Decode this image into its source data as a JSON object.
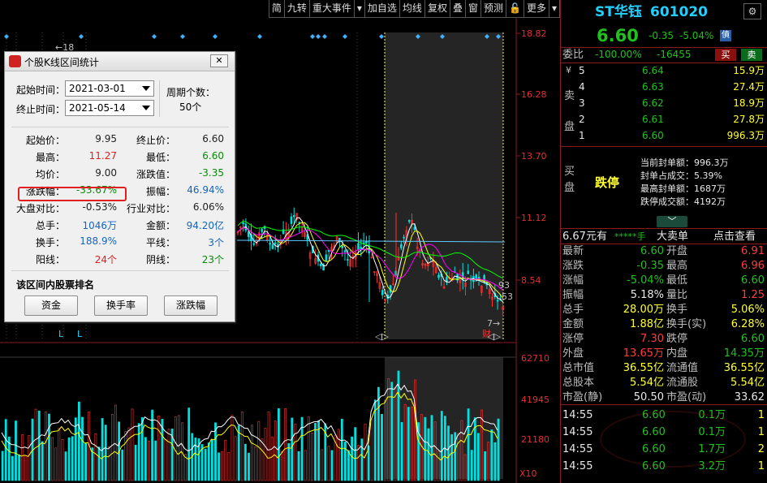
{
  "toolbar": {
    "items": [
      "简",
      "九转",
      "重大事件",
      "▾",
      "加自选",
      "均线",
      "复权",
      "叠",
      "窗",
      "预测",
      "🔓",
      "更多",
      "▾"
    ]
  },
  "chart": {
    "price_axis": [
      "18.82",
      "16.28",
      "13.70",
      "11.12",
      "8.54"
    ],
    "volume_axis": [
      "62710",
      "41945",
      "21180"
    ],
    "volume_unit": "X10",
    "high_marker": "18",
    "low_markers": [
      "L",
      "L"
    ],
    "last_price_marker": "7",
    "low_price_label": "93",
    "low_price_label2": "53",
    "finance_label": "财",
    "colors": {
      "up": "#ff3030",
      "down": "#00e0e0",
      "ma5": "#ffffff",
      "ma10": "#ffff00",
      "ma20": "#ff00ff",
      "ma60": "#00ff00",
      "ma120": "#5fc8ff",
      "selection": "#444444"
    }
  },
  "dialog": {
    "title": "个股K线区间统计",
    "start_label": "起始时间：",
    "start_value": "2021-03-01",
    "end_label": "终止时间：",
    "end_value": "2021-05-14",
    "period_label": "周期个数：",
    "period_value": "50个",
    "stats": [
      {
        "l": "起始价：",
        "v": "9.95",
        "vc": "gray",
        "l2": "终止价：",
        "v2": "6.60",
        "v2c": "gray"
      },
      {
        "l": "最高：",
        "v": "11.27",
        "vc": "red",
        "l2": "最低：",
        "v2": "6.60",
        "v2c": "grn"
      },
      {
        "l": "均价：",
        "v": "9.00",
        "vc": "gray",
        "l2": "涨跌值：",
        "v2": "-3.35",
        "v2c": "grn"
      },
      {
        "l": "涨跌幅：",
        "v": "-33.67%",
        "vc": "grn",
        "l2": "振幅：",
        "v2": "46.94%",
        "v2c": "blue"
      },
      {
        "l": "大盘对比：",
        "v": "-0.53%",
        "vc": "gray",
        "l2": "行业对比：",
        "v2": "6.06%",
        "v2c": "gray"
      },
      {
        "l": "总手：",
        "v": "1046万",
        "vc": "blue",
        "l2": "金额：",
        "v2": "94.20亿",
        "v2c": "blue"
      },
      {
        "l": "换手：",
        "v": "188.9%",
        "vc": "blue",
        "l2": "平线：",
        "v2": "3个",
        "v2c": "blue"
      },
      {
        "l": "阳线：",
        "v": "24个",
        "vc": "red",
        "l2": "阴线：",
        "v2": "23个",
        "v2c": "grn"
      }
    ],
    "rank_title": "该区间内股票排名",
    "buttons": [
      "资金",
      "换手率",
      "涨跌幅"
    ]
  },
  "quote": {
    "name": "ST华钰",
    "code": "601020",
    "price": "6.60",
    "change": "-0.35",
    "pct": "-5.04%",
    "badge": "債",
    "wb_label": "委比",
    "wb_pct": "-100.00%",
    "wb_val": "-16455",
    "buy_btn": "买",
    "sell_btn": "卖",
    "sell_side": "卖盘",
    "yen": "¥",
    "asks": [
      {
        "lvl": "5",
        "p": "6.64",
        "v": "15.9万"
      },
      {
        "lvl": "4",
        "p": "6.63",
        "v": "27.4万"
      },
      {
        "lvl": "3",
        "p": "6.62",
        "v": "18.9万"
      },
      {
        "lvl": "2",
        "p": "6.61",
        "v": "27.8万"
      },
      {
        "lvl": "1",
        "p": "6.60",
        "v": "996.3万"
      }
    ],
    "buy_side": "买盘",
    "limit_label": "跌停",
    "seal": [
      "当前封单额：996.3万",
      "封单占成交：5.39%",
      "最高封单额：1687万",
      "跌停成交额：4192万"
    ],
    "tabs": {
      "price": "6.67元有",
      "stars": "*****手",
      "big": "大卖单",
      "detail": "点击查看"
    },
    "fields": [
      [
        "最新",
        "6.60",
        "grn",
        "开盘",
        "6.91",
        "red"
      ],
      [
        "涨跌",
        "-0.35",
        "grn",
        "最高",
        "6.96",
        "red"
      ],
      [
        "涨幅",
        "-5.04%",
        "grn",
        "最低",
        "6.60",
        "grn"
      ],
      [
        "振幅",
        "5.18%",
        "wht",
        "量比",
        "1.25",
        "red"
      ],
      [
        "总手",
        "28.00万",
        "yel",
        "换手",
        "5.06%",
        "yel"
      ],
      [
        "金额",
        "1.88亿",
        "yel",
        "换手(实)",
        "6.28%",
        "yel"
      ],
      [
        "涨停",
        "7.30",
        "red",
        "跌停",
        "6.60",
        "grn"
      ],
      [
        "外盘",
        "13.65万",
        "red",
        "内盘",
        "14.35万",
        "grn"
      ],
      [
        "总市值",
        "36.55亿",
        "yel",
        "流通值",
        "36.55亿",
        "yel"
      ],
      [
        "总股本",
        "5.54亿",
        "yel",
        "流通股",
        "5.54亿",
        "yel"
      ],
      [
        "市盈(静)",
        "50.50",
        "wht",
        "市盈(动)",
        "33.62",
        "wht"
      ]
    ],
    "ticks": [
      {
        "t": "14:55",
        "p": "6.60",
        "v": "0.1万",
        "n": "1"
      },
      {
        "t": "14:55",
        "p": "6.60",
        "v": "0.1万",
        "n": "1"
      },
      {
        "t": "14:55",
        "p": "6.60",
        "v": "1.7万",
        "n": "2"
      },
      {
        "t": "14:55",
        "p": "6.60",
        "v": "3.2万",
        "n": "1"
      }
    ]
  }
}
